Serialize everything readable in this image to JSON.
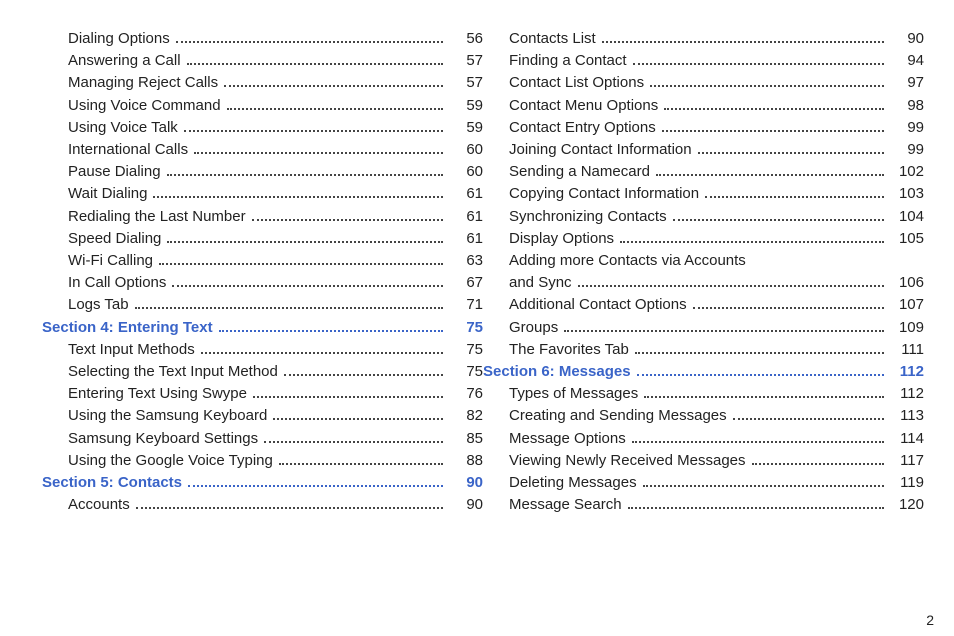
{
  "page_number": "2",
  "left_column": [
    {
      "type": "sub",
      "title": "Dialing Options",
      "page": "56"
    },
    {
      "type": "sub",
      "title": "Answering a Call",
      "page": "57"
    },
    {
      "type": "sub",
      "title": "Managing Reject Calls",
      "page": "57"
    },
    {
      "type": "sub",
      "title": "Using Voice Command",
      "page": "59"
    },
    {
      "type": "sub",
      "title": "Using Voice Talk",
      "page": "59"
    },
    {
      "type": "sub",
      "title": "International Calls",
      "page": "60"
    },
    {
      "type": "sub",
      "title": "Pause Dialing",
      "page": "60"
    },
    {
      "type": "sub",
      "title": "Wait Dialing",
      "page": "61"
    },
    {
      "type": "sub",
      "title": "Redialing the Last Number",
      "page": "61"
    },
    {
      "type": "sub",
      "title": "Speed Dialing",
      "page": "61"
    },
    {
      "type": "sub",
      "title": "Wi-Fi Calling",
      "page": "63"
    },
    {
      "type": "sub",
      "title": "In Call Options",
      "page": "67"
    },
    {
      "type": "sub",
      "title": "Logs Tab",
      "page": "71"
    },
    {
      "type": "sec",
      "title": "Section 4:  Entering Text",
      "page": "75"
    },
    {
      "type": "sub",
      "title": "Text Input Methods",
      "page": "75"
    },
    {
      "type": "sub",
      "title": "Selecting the Text Input Method",
      "page": "75"
    },
    {
      "type": "sub",
      "title": "Entering Text Using Swype",
      "page": "76"
    },
    {
      "type": "sub",
      "title": "Using the Samsung Keyboard",
      "page": "82"
    },
    {
      "type": "sub",
      "title": "Samsung Keyboard Settings",
      "page": "85"
    },
    {
      "type": "sub",
      "title": "Using the Google Voice Typing",
      "page": "88"
    },
    {
      "type": "sec",
      "title": "Section 5:  Contacts",
      "page": "90"
    },
    {
      "type": "sub",
      "title": "Accounts",
      "page": "90"
    }
  ],
  "right_column": [
    {
      "type": "sub",
      "title": "Contacts List",
      "page": "90"
    },
    {
      "type": "sub",
      "title": "Finding a Contact",
      "page": "94"
    },
    {
      "type": "sub",
      "title": "Contact List Options",
      "page": "97"
    },
    {
      "type": "sub",
      "title": "Contact Menu Options",
      "page": "98"
    },
    {
      "type": "sub",
      "title": "Contact Entry Options",
      "page": "99"
    },
    {
      "type": "sub",
      "title": "Joining Contact Information",
      "page": "99"
    },
    {
      "type": "sub",
      "title": "Sending a Namecard",
      "page": "102"
    },
    {
      "type": "sub",
      "title": "Copying Contact Information",
      "page": "103"
    },
    {
      "type": "sub",
      "title": "Synchronizing Contacts",
      "page": "104"
    },
    {
      "type": "sub",
      "title": "Display Options",
      "page": "105"
    },
    {
      "type": "sub-noleader",
      "title": "Adding more Contacts via Accounts",
      "page": ""
    },
    {
      "type": "sub-cont",
      "title": "and Sync",
      "page": "106"
    },
    {
      "type": "sub",
      "title": "Additional Contact Options",
      "page": "107"
    },
    {
      "type": "sub",
      "title": "Groups",
      "page": "109"
    },
    {
      "type": "sub",
      "title": "The Favorites Tab",
      "page": "111"
    },
    {
      "type": "sec",
      "title": "Section 6:  Messages",
      "page": "112"
    },
    {
      "type": "sub",
      "title": "Types of Messages",
      "page": "112"
    },
    {
      "type": "sub",
      "title": "Creating and Sending Messages",
      "page": "113"
    },
    {
      "type": "sub",
      "title": "Message Options",
      "page": "114"
    },
    {
      "type": "sub",
      "title": "Viewing Newly Received Messages",
      "page": "117"
    },
    {
      "type": "sub",
      "title": "Deleting Messages",
      "page": "119"
    },
    {
      "type": "sub",
      "title": "Message Search",
      "page": "120"
    }
  ]
}
